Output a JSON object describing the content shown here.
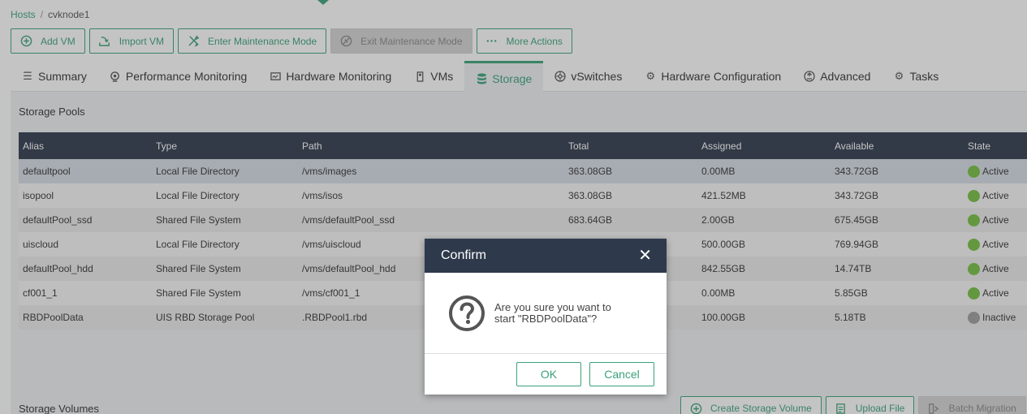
{
  "breadcrumb": {
    "root": "Hosts",
    "separator": "/",
    "current": "cvknode1"
  },
  "toolbar": {
    "add_vm": "Add VM",
    "import_vm": "Import VM",
    "enter_maintenance": "Enter Maintenance Mode",
    "exit_maintenance": "Exit Maintenance Mode",
    "more_actions": "More Actions"
  },
  "tabs": [
    {
      "label": "Summary",
      "icon": "list-icon"
    },
    {
      "label": "Performance Monitoring",
      "icon": "gauge-icon"
    },
    {
      "label": "Hardware Monitoring",
      "icon": "monitor-icon"
    },
    {
      "label": "VMs",
      "icon": "vm-icon"
    },
    {
      "label": "Storage",
      "icon": "database-icon"
    },
    {
      "label": "vSwitches",
      "icon": "switch-icon"
    },
    {
      "label": "Hardware Configuration",
      "icon": "gear-icon"
    },
    {
      "label": "Advanced",
      "icon": "advanced-icon"
    },
    {
      "label": "Tasks",
      "icon": "tasks-icon"
    }
  ],
  "active_tab": "Storage",
  "storage_pools": {
    "title": "Storage Pools",
    "columns": [
      "Alias",
      "Type",
      "Path",
      "Total",
      "Assigned",
      "Available",
      "State"
    ],
    "rows": [
      {
        "alias": "defaultpool",
        "type": "Local File Directory",
        "path": "/vms/images",
        "total": "363.08GB",
        "assigned": "0.00MB",
        "available": "343.72GB",
        "state": "Active"
      },
      {
        "alias": "isopool",
        "type": "Local File Directory",
        "path": "/vms/isos",
        "total": "363.08GB",
        "assigned": "421.52MB",
        "available": "343.72GB",
        "state": "Active"
      },
      {
        "alias": "defaultPool_ssd",
        "type": "Shared File System",
        "path": "/vms/defaultPool_ssd",
        "total": "683.64GB",
        "assigned": "2.00GB",
        "available": "675.45GB",
        "state": "Active"
      },
      {
        "alias": "uiscloud",
        "type": "Local File Directory",
        "path": "/vms/uiscloud",
        "total": "",
        "assigned": "500.00GB",
        "available": "769.94GB",
        "state": "Active"
      },
      {
        "alias": "defaultPool_hdd",
        "type": "Shared File System",
        "path": "/vms/defaultPool_hdd",
        "total": "",
        "assigned": "842.55GB",
        "available": "14.74TB",
        "state": "Active"
      },
      {
        "alias": "cf001_1",
        "type": "Shared File System",
        "path": "/vms/cf001_1",
        "total": "",
        "assigned": "0.00MB",
        "available": "5.85GB",
        "state": "Active"
      },
      {
        "alias": "RBDPoolData",
        "type": "UIS RBD Storage Pool",
        "path": ".RBDPool1.rbd",
        "total": "",
        "assigned": "100.00GB",
        "available": "5.18TB",
        "state": "Inactive"
      }
    ]
  },
  "storage_volumes": {
    "title": "Storage Volumes",
    "create": "Create Storage Volume",
    "upload": "Upload File",
    "batch_migration": "Batch Migration"
  },
  "dialog": {
    "title": "Confirm",
    "message": "Are you sure you want to start \"RBDPoolData\"?",
    "ok": "OK",
    "cancel": "Cancel"
  },
  "colors": {
    "accent": "#3aa27a",
    "header_bg": "#2e3a4c",
    "active_state": "#76c043",
    "inactive_state": "#9e9e9e"
  }
}
